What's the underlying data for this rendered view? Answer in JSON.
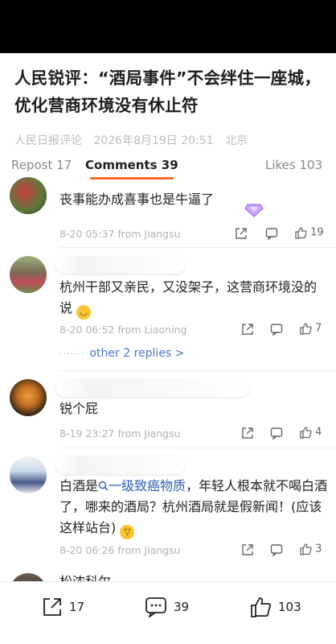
{
  "article": {
    "title": "人民锐评：“酒局事件”不会绊住一座城，优化营商环境没有休止符",
    "source": "人民日报评论",
    "date": "2026年8月19日 20:51",
    "location": "北京"
  },
  "tabs": [
    {
      "label": "Repost",
      "count": "17"
    },
    {
      "label": "Comments",
      "count": "39",
      "active": true
    },
    {
      "label": "Likes",
      "count": "103"
    }
  ],
  "comments": [
    {
      "text": "丧事能办成喜事也是牛逼了",
      "date": "8-20 05:37",
      "from": "from Jiangsu",
      "likes": "19",
      "emoji": "gem-icon"
    },
    {
      "text": "杭州干部又亲民，又没架子，这营商环境没的说",
      "date": "8-20 06:52",
      "from": "from Liaoning",
      "likes": "7",
      "replies": "other 2 replies >"
    },
    {
      "text": "锐个屁",
      "date": "8-19 23:27",
      "from": "from Jiangsu",
      "likes": "4"
    },
    {
      "text_before": "白酒是",
      "link": "一级致癌物质",
      "text_after": "，年轻人根本就不喝白酒了，哪来的酒局？杭州酒局就是假新闻！(应该这样站台)",
      "date": "8-20 06:26",
      "from": "from Jiangsu",
      "likes": "3"
    },
    {
      "text": "松浓科尔"
    }
  ],
  "bottom_bar": {
    "repost": "17",
    "comments": "39",
    "likes": "103"
  }
}
